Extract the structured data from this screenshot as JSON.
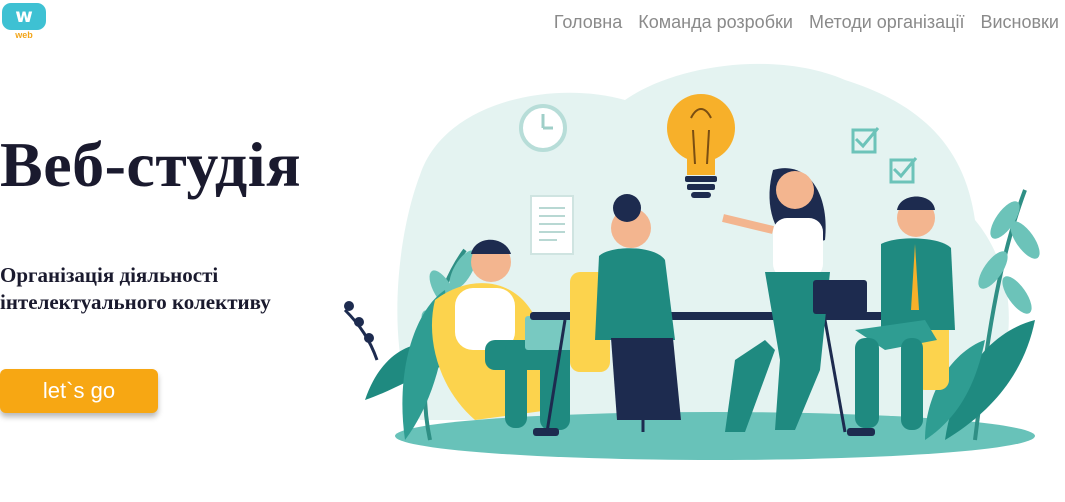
{
  "logo": {
    "mark": "w",
    "caption": "web"
  },
  "nav": {
    "items": [
      {
        "label": "Головна"
      },
      {
        "label": "Команда розробки"
      },
      {
        "label": "Методи організації"
      },
      {
        "label": "Висновки"
      }
    ]
  },
  "hero": {
    "title": "Веб-студія",
    "subtitle": "Організація діяльності інтелектуального колективу",
    "cta_label": "let`s go"
  },
  "illustration": {
    "icon": "team-meeting-illustration"
  },
  "colors": {
    "accent": "#f7a713",
    "teal": "#1f8a80",
    "logo": "#3ec1d3",
    "nav_text": "#8a8a8a",
    "heading": "#1a1a2e"
  }
}
